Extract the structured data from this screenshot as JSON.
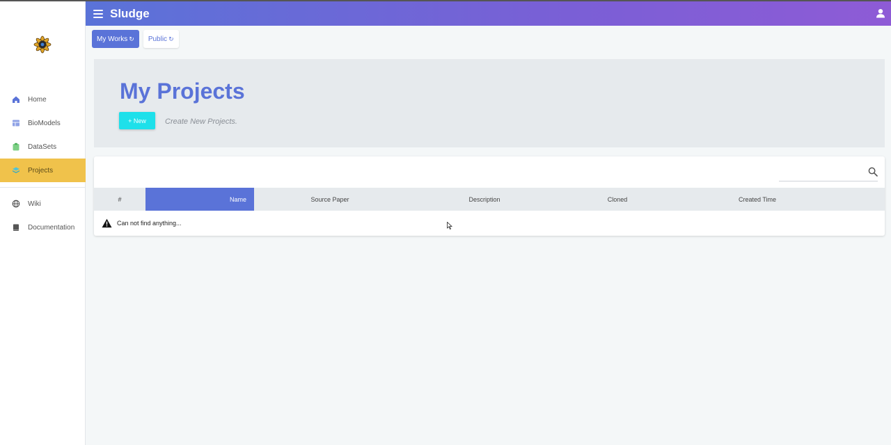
{
  "app": {
    "title": "Sludge"
  },
  "sidebar": {
    "items": [
      {
        "label": "Home",
        "icon": "home-icon"
      },
      {
        "label": "BioModels",
        "icon": "table-icon"
      },
      {
        "label": "DataSets",
        "icon": "clipboard-icon"
      },
      {
        "label": "Projects",
        "icon": "layers-icon",
        "active": true
      },
      {
        "label": "Wiki",
        "icon": "globe-icon"
      },
      {
        "label": "Documentation",
        "icon": "book-icon"
      }
    ]
  },
  "tabs": [
    {
      "label": "My Works",
      "active": true
    },
    {
      "label": "Public",
      "active": false
    }
  ],
  "hero": {
    "title": "My Projects",
    "new_button": "+ New",
    "subtitle": "Create New Projects."
  },
  "table": {
    "search_placeholder": "",
    "columns": [
      "#",
      "Name",
      "Source Paper",
      "Description",
      "Cloned",
      "Created Time"
    ],
    "empty_message": "Can not find anything..."
  },
  "colors": {
    "accent": "#5a73d8",
    "active_nav": "#f0c24b",
    "new_button": "#1ee0ea"
  }
}
